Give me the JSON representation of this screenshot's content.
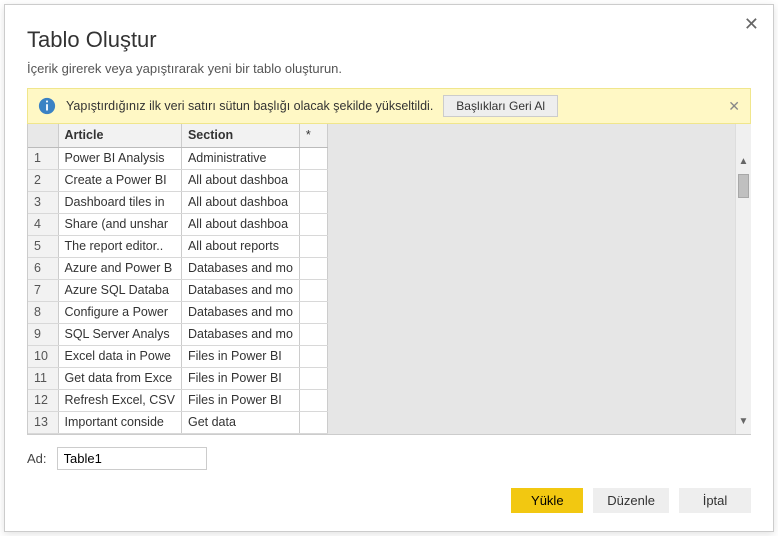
{
  "dialog": {
    "title": "Tablo Oluştur",
    "subtitle": "İçerik girerek veya yapıştırarak yeni bir tablo oluşturun.",
    "close_glyph": "✕"
  },
  "info": {
    "message": "Yapıştırdığınız ilk veri satırı sütun başlığı olacak şekilde yükseltildi.",
    "undo_label": "Başlıkları Geri Al",
    "close_glyph": "✕"
  },
  "grid": {
    "columns": {
      "c1": "Article",
      "c2": "Section",
      "star": "*"
    },
    "rows": [
      {
        "idx": "1",
        "c1": "Power BI Analysis",
        "c2": "Administrative"
      },
      {
        "idx": "2",
        "c1": "Create a Power BI",
        "c2": "All about dashboa"
      },
      {
        "idx": "3",
        "c1": "Dashboard tiles in",
        "c2": "All about dashboa"
      },
      {
        "idx": "4",
        "c1": "Share (and unshar",
        "c2": "All about dashboa"
      },
      {
        "idx": "5",
        "c1": "The report editor..",
        "c2": "All about reports"
      },
      {
        "idx": "6",
        "c1": "Azure and Power B",
        "c2": "Databases and mo"
      },
      {
        "idx": "7",
        "c1": "Azure SQL Databa",
        "c2": "Databases and mo"
      },
      {
        "idx": "8",
        "c1": "Configure a Power",
        "c2": "Databases and mo"
      },
      {
        "idx": "9",
        "c1": "SQL Server Analys",
        "c2": "Databases and mo"
      },
      {
        "idx": "10",
        "c1": "Excel data in Powe",
        "c2": "Files in Power BI"
      },
      {
        "idx": "11",
        "c1": "Get data from Exce",
        "c2": "Files in Power BI"
      },
      {
        "idx": "12",
        "c1": "Refresh Excel, CSV",
        "c2": "Files in Power BI"
      },
      {
        "idx": "13",
        "c1": "Important conside",
        "c2": "Get data"
      }
    ]
  },
  "name": {
    "label": "Ad:",
    "value": "Table1"
  },
  "footer": {
    "load": "Yükle",
    "edit": "Düzenle",
    "cancel": "İptal"
  },
  "scroll": {
    "up": "▲",
    "down": "▼"
  }
}
